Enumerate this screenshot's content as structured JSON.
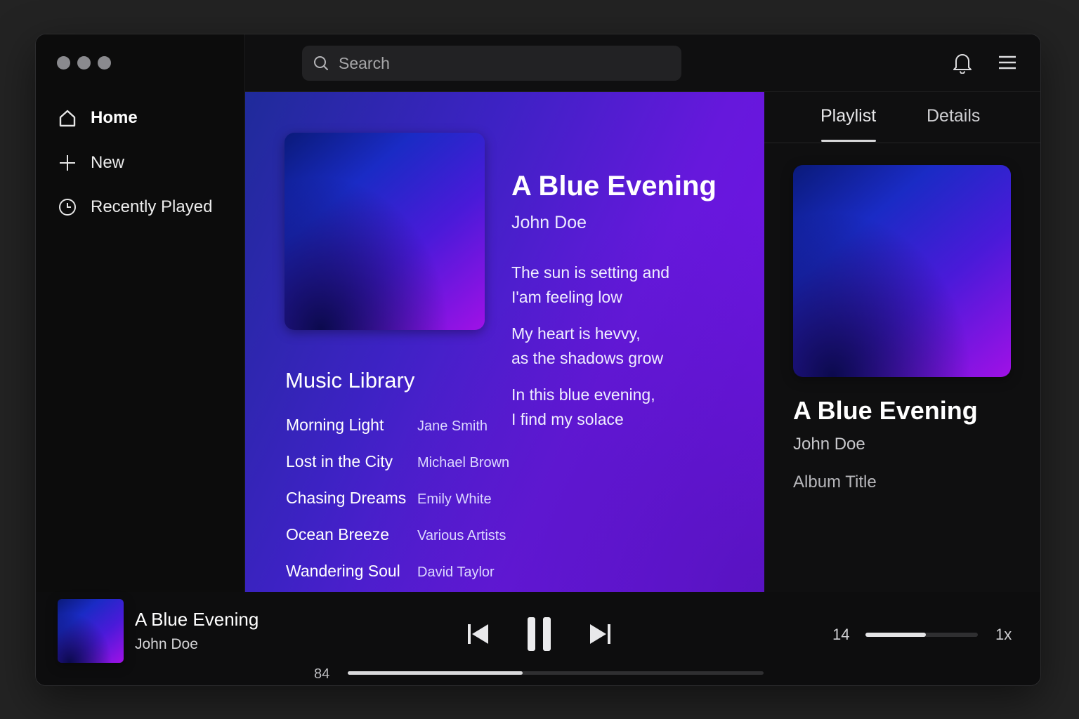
{
  "sidebar": {
    "items": [
      {
        "label": "Home",
        "icon": "home-icon",
        "active": true
      },
      {
        "label": "New",
        "icon": "plus-icon"
      },
      {
        "label": "Recently Played",
        "icon": "clock-icon"
      }
    ]
  },
  "search": {
    "placeholder": "Search"
  },
  "now_playing": {
    "title": "A Blue Evening",
    "artist": "John Doe",
    "lyrics": [
      "The sun is setting and\nI'am feeling low",
      "My heart is hevvy,\nas the shadows grow",
      "In this blue evening,\nI find my solace"
    ]
  },
  "library": {
    "title": "Music Library",
    "tracks": [
      {
        "name": "Morning Light",
        "artist": "Jane Smith"
      },
      {
        "name": "Lost in the City",
        "artist": "Michael Brown"
      },
      {
        "name": "Chasing Dreams",
        "artist": "Emily White"
      },
      {
        "name": "Ocean Breeze",
        "artist": "Various Artists"
      },
      {
        "name": "Wandering Soul",
        "artist": "David Taylor"
      }
    ]
  },
  "right_panel": {
    "tabs": [
      {
        "label": "Playlist",
        "active": true
      },
      {
        "label": "Details"
      }
    ],
    "title": "A Blue Evening",
    "artist": "John Doe",
    "album": "Album Title"
  },
  "player": {
    "title": "A Blue Evening",
    "artist": "John Doe",
    "progress_label": "84",
    "progress_fraction": 0.42,
    "volume_label": "14",
    "volume_fraction": 0.54,
    "speed": "1x"
  },
  "colors": {
    "window_bg": "#0f0f10",
    "accent_purple": "#6618dc",
    "accent_blue": "#1f2b9a"
  }
}
